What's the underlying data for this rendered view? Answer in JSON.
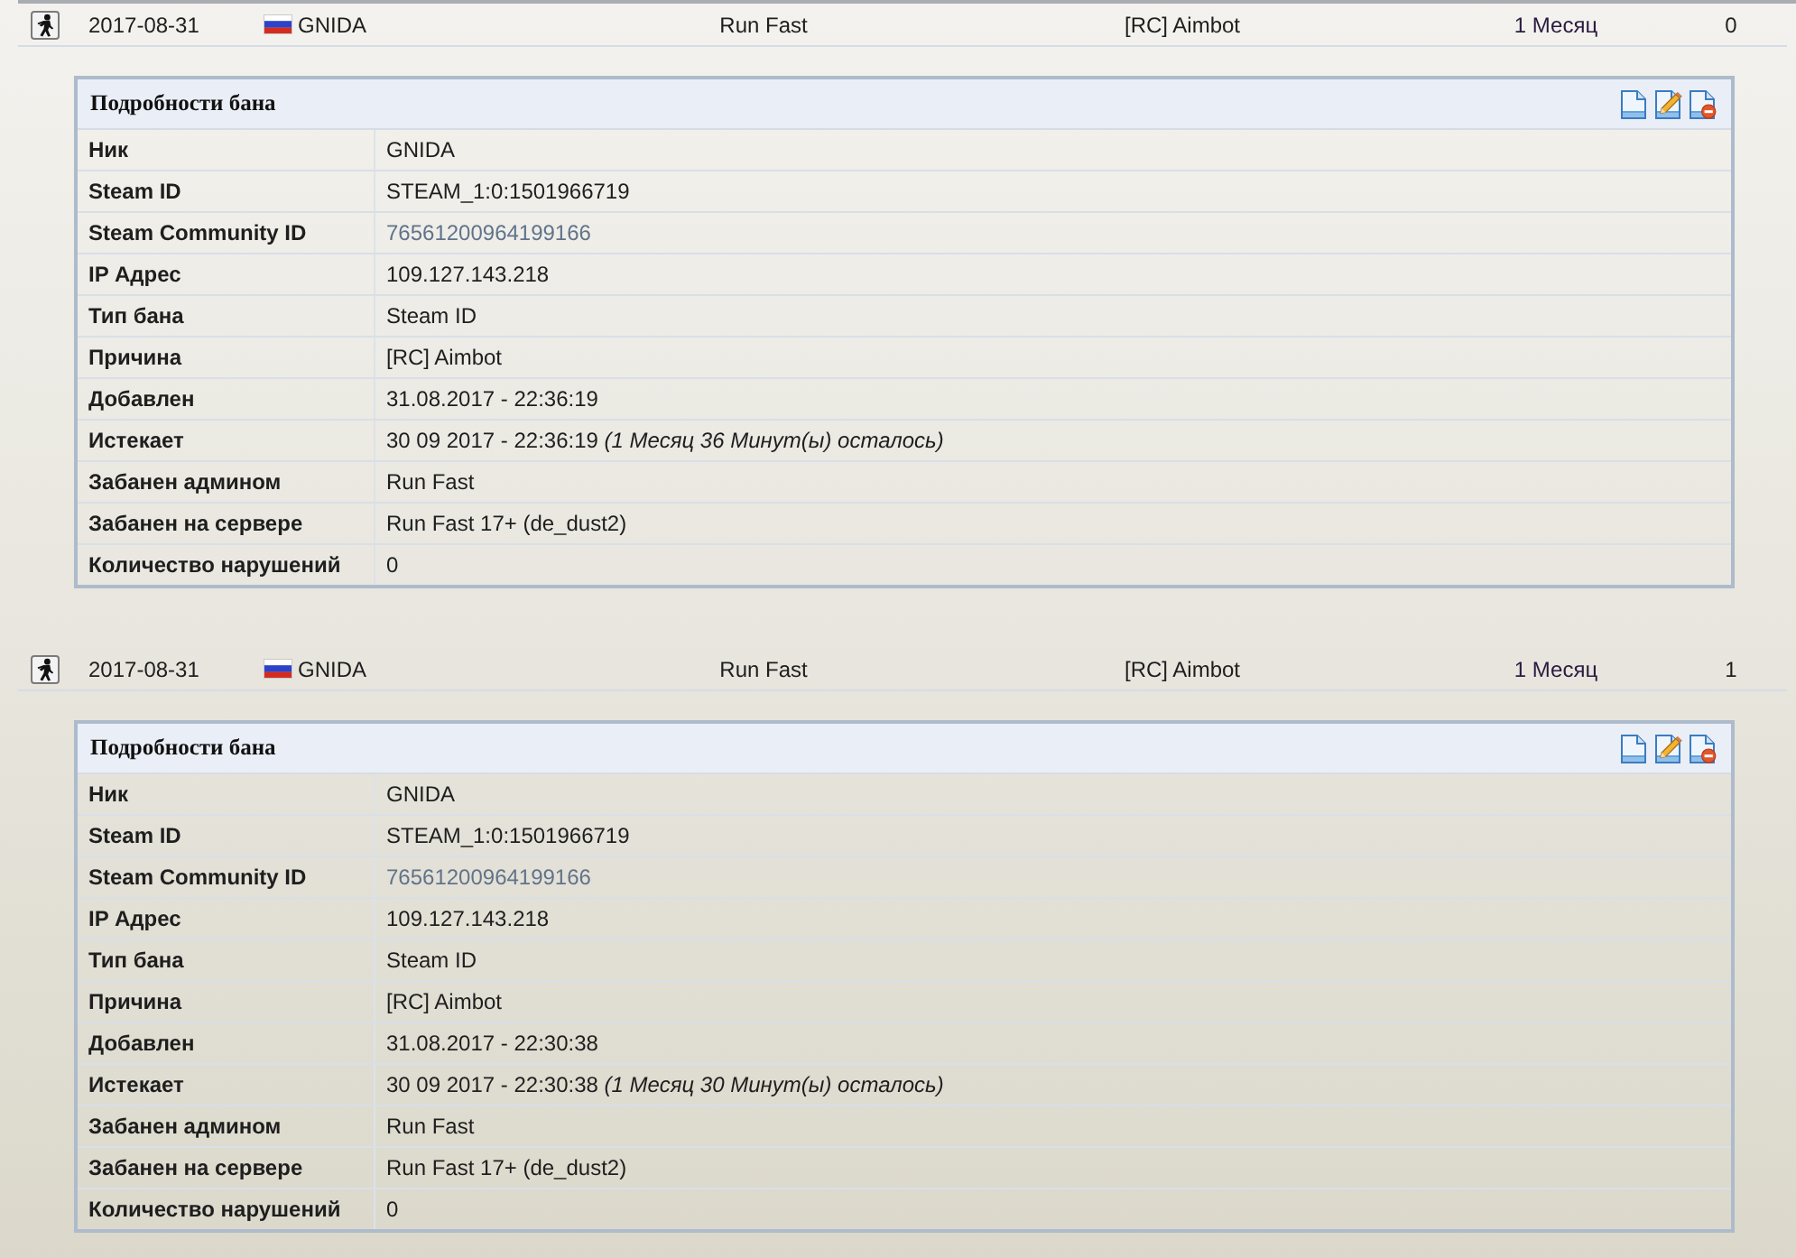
{
  "bans": [
    {
      "row": {
        "date": "2017-08-31",
        "player": "GNIDA",
        "admin": "Run Fast",
        "reason": "[RC] Aimbot",
        "length": "1 Месяц",
        "column_6": "0"
      },
      "details": {
        "title": "Подробности бана",
        "fields": [
          {
            "label": "Ник",
            "value": "GNIDA",
            "kind": "text"
          },
          {
            "label": "Steam ID",
            "value": "STEAM_1:0:1501966719",
            "kind": "text"
          },
          {
            "label": "Steam Community ID",
            "value": "76561200964199166",
            "kind": "link"
          },
          {
            "label": "IP Адрес",
            "value": "109.127.143.218",
            "kind": "text"
          },
          {
            "label": "Тип бана",
            "value": "Steam ID",
            "kind": "text"
          },
          {
            "label": "Причина",
            "value": "[RC] Aimbot",
            "kind": "text"
          },
          {
            "label": "Добавлен",
            "value": "31.08.2017 - 22:36:19",
            "kind": "text"
          },
          {
            "label": "Истекает",
            "value": "30 09 2017 - 22:36:19 *(1 Месяц 36 Минут(ы) осталось)*",
            "kind": "text"
          },
          {
            "label": "Забанен админом",
            "value": "Run Fast",
            "kind": "text"
          },
          {
            "label": "Забанен на сервере",
            "value": "Run Fast 17+ (de_dust2)",
            "kind": "text"
          },
          {
            "label": "Количество нарушений",
            "value": "0",
            "kind": "text"
          }
        ]
      }
    },
    {
      "row": {
        "date": "2017-08-31",
        "player": "GNIDA",
        "admin": "Run Fast",
        "reason": "[RC] Aimbot",
        "length": "1 Месяц",
        "column_6": "1"
      },
      "details": {
        "title": "Подробности бана",
        "fields": [
          {
            "label": "Ник",
            "value": "GNIDA",
            "kind": "text"
          },
          {
            "label": "Steam ID",
            "value": "STEAM_1:0:1501966719",
            "kind": "text"
          },
          {
            "label": "Steam Community ID",
            "value": "76561200964199166",
            "kind": "link"
          },
          {
            "label": "IP Адрес",
            "value": "109.127.143.218",
            "kind": "text"
          },
          {
            "label": "Тип бана",
            "value": "Steam ID",
            "kind": "text"
          },
          {
            "label": "Причина",
            "value": "[RC] Aimbot",
            "kind": "text"
          },
          {
            "label": "Добавлен",
            "value": "31.08.2017 - 22:30:38",
            "kind": "text"
          },
          {
            "label": "Истекает",
            "value": "30 09 2017 - 22:30:38 *(1 Месяц 30 Минут(ы) осталось)*",
            "kind": "text"
          },
          {
            "label": "Забанен админом",
            "value": "Run Fast",
            "kind": "text"
          },
          {
            "label": "Забанен на сервере",
            "value": "Run Fast 17+ (de_dust2)",
            "kind": "text"
          },
          {
            "label": "Количество нарушений",
            "value": "0",
            "kind": "text"
          }
        ]
      }
    }
  ]
}
